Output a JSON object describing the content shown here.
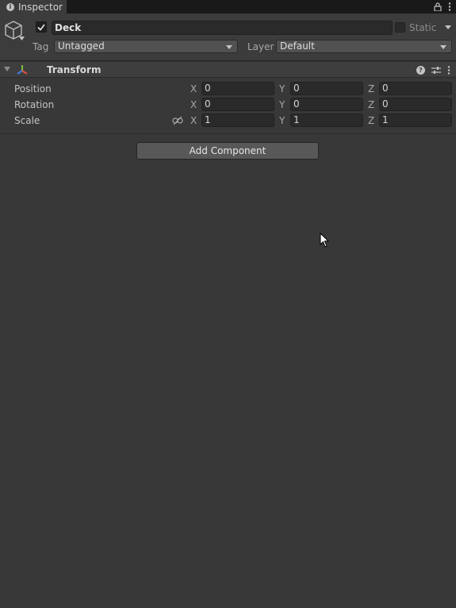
{
  "tab": {
    "label": "Inspector"
  },
  "object": {
    "name": "Deck",
    "active": true,
    "static_label": "Static"
  },
  "tag": {
    "label": "Tag",
    "value": "Untagged"
  },
  "layer": {
    "label": "Layer",
    "value": "Default"
  },
  "transform": {
    "title": "Transform",
    "rows": [
      {
        "label": "Position",
        "x": "0",
        "y": "0",
        "z": "0"
      },
      {
        "label": "Rotation",
        "x": "0",
        "y": "0",
        "z": "0"
      },
      {
        "label": "Scale",
        "x": "1",
        "y": "1",
        "z": "1"
      }
    ],
    "axes": {
      "x": "X",
      "y": "Y",
      "z": "Z"
    }
  },
  "add_component_label": "Add Component"
}
